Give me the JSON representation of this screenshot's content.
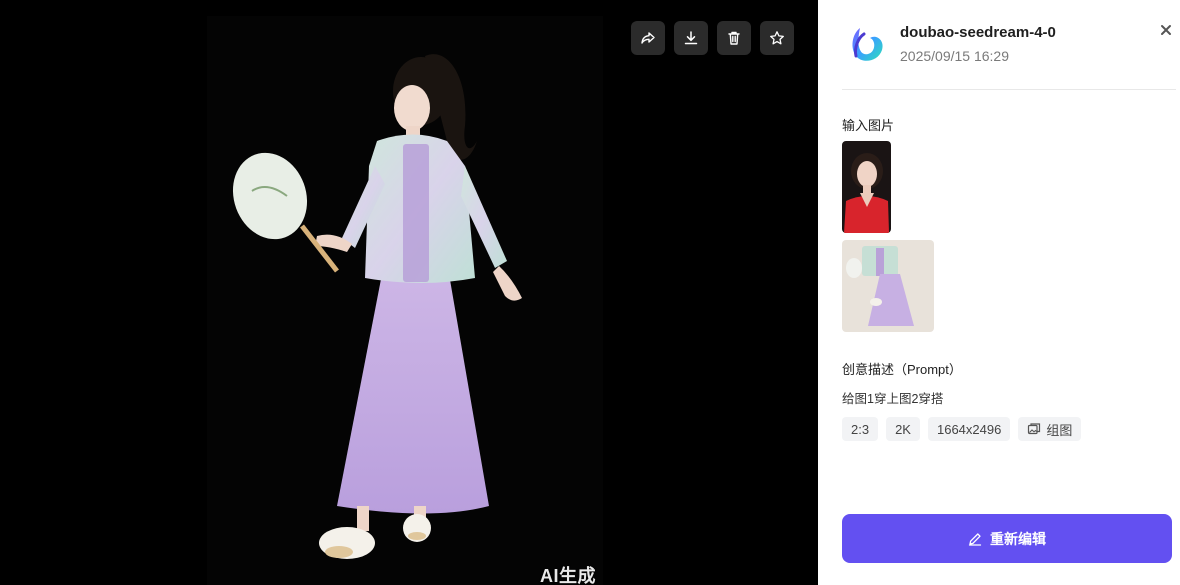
{
  "viewer": {
    "watermark": "AI生成",
    "toolbar": {
      "share": "share-icon",
      "download": "download-icon",
      "delete": "trash-icon",
      "favorite": "star-icon"
    }
  },
  "panel": {
    "model_name": "doubao-seedream-4-0",
    "timestamp": "2025/09/15 16:29",
    "input_images_title": "输入图片",
    "prompt_title": "创意描述（Prompt）",
    "prompt_text": "给图1穿上图2穿搭",
    "tags": {
      "ratio": "2:3",
      "resolution": "2K",
      "size": "1664x2496",
      "group": "组图"
    },
    "edit_button": "重新编辑"
  },
  "colors": {
    "accent": "#6350f1",
    "tag_bg": "#f2f3f5",
    "toolbar_bg": "#2b2b2b"
  }
}
